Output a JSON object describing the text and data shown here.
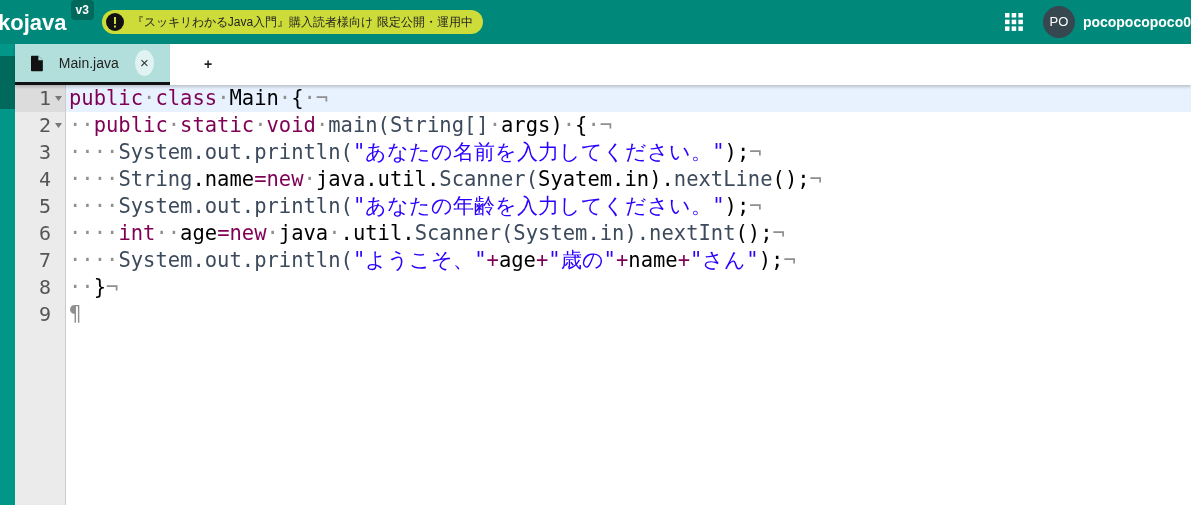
{
  "header": {
    "brand": "kojava",
    "version": "v3",
    "notice": "『スッキリわかるJava入門』購入読者様向け 限定公開・運用中",
    "avatar": "PO",
    "username": "pocopocopoco0"
  },
  "tabs": [
    {
      "label": "Main.java",
      "kind": "file",
      "selected": true,
      "close": "×"
    },
    {
      "label": "+",
      "kind": "add",
      "selected": false
    }
  ],
  "editor": {
    "lines": [
      {
        "number": "1",
        "foldable": true,
        "active": true,
        "tokens": [
          {
            "kind": "keyword",
            "text": "public"
          },
          {
            "kind": "ws",
            "text": "·"
          },
          {
            "kind": "keyword",
            "text": "class"
          },
          {
            "kind": "ws",
            "text": "·"
          },
          {
            "kind": "plain",
            "text": "Main"
          },
          {
            "kind": "ws",
            "text": "·"
          },
          {
            "kind": "plain",
            "text": "{"
          },
          {
            "kind": "ws",
            "text": "·¬"
          }
        ]
      },
      {
        "number": "2",
        "foldable": true,
        "active": false,
        "tokens": [
          {
            "kind": "ws",
            "text": "··"
          },
          {
            "kind": "keyword",
            "text": "public"
          },
          {
            "kind": "ws",
            "text": "·"
          },
          {
            "kind": "keyword",
            "text": "static"
          },
          {
            "kind": "ws",
            "text": "·"
          },
          {
            "kind": "keyword",
            "text": "void"
          },
          {
            "kind": "ws",
            "text": "·"
          },
          {
            "kind": "ident",
            "text": "main(String[]"
          },
          {
            "kind": "ws",
            "text": "·"
          },
          {
            "kind": "plain",
            "text": "args)"
          },
          {
            "kind": "ws",
            "text": "·"
          },
          {
            "kind": "plain",
            "text": "{"
          },
          {
            "kind": "ws",
            "text": "·¬"
          }
        ]
      },
      {
        "number": "3",
        "foldable": false,
        "active": false,
        "tokens": [
          {
            "kind": "ws",
            "text": "····"
          },
          {
            "kind": "ident",
            "text": "System.out.println("
          },
          {
            "kind": "string",
            "text": "\"あなたの名前を入力してください。\""
          },
          {
            "kind": "plain",
            "text": ");"
          },
          {
            "kind": "ws",
            "text": "¬"
          }
        ]
      },
      {
        "number": "4",
        "foldable": false,
        "active": false,
        "tokens": [
          {
            "kind": "ws",
            "text": "····"
          },
          {
            "kind": "ident",
            "text": "String"
          },
          {
            "kind": "plain",
            "text": ".name"
          },
          {
            "kind": "operator",
            "text": "="
          },
          {
            "kind": "keyword",
            "text": "new"
          },
          {
            "kind": "ws",
            "text": "·"
          },
          {
            "kind": "plain",
            "text": "java.util."
          },
          {
            "kind": "ident",
            "text": "Scanner("
          },
          {
            "kind": "plain",
            "text": "Syatem.in)."
          },
          {
            "kind": "ident",
            "text": "nextLine"
          },
          {
            "kind": "plain",
            "text": "();"
          },
          {
            "kind": "ws",
            "text": "¬"
          }
        ]
      },
      {
        "number": "5",
        "foldable": false,
        "active": false,
        "tokens": [
          {
            "kind": "ws",
            "text": "····"
          },
          {
            "kind": "ident",
            "text": "System.out.println("
          },
          {
            "kind": "string",
            "text": "\"あなたの年齢を入力してください。\""
          },
          {
            "kind": "plain",
            "text": ");"
          },
          {
            "kind": "ws",
            "text": "¬"
          }
        ]
      },
      {
        "number": "6",
        "foldable": false,
        "active": false,
        "tokens": [
          {
            "kind": "ws",
            "text": "····"
          },
          {
            "kind": "keyword",
            "text": "int"
          },
          {
            "kind": "ws",
            "text": "··"
          },
          {
            "kind": "plain",
            "text": "age"
          },
          {
            "kind": "operator",
            "text": "="
          },
          {
            "kind": "keyword",
            "text": "new"
          },
          {
            "kind": "ws",
            "text": "·"
          },
          {
            "kind": "plain",
            "text": "java"
          },
          {
            "kind": "ws",
            "text": "·"
          },
          {
            "kind": "plain",
            "text": ".util."
          },
          {
            "kind": "ident",
            "text": "Scanner(System.in).nextInt"
          },
          {
            "kind": "plain",
            "text": "();"
          },
          {
            "kind": "ws",
            "text": "¬"
          }
        ]
      },
      {
        "number": "7",
        "foldable": false,
        "active": false,
        "tokens": [
          {
            "kind": "ws",
            "text": "····"
          },
          {
            "kind": "ident",
            "text": "System.out.println("
          },
          {
            "kind": "string",
            "text": "\"ようこそ、\""
          },
          {
            "kind": "operator",
            "text": "+"
          },
          {
            "kind": "plain",
            "text": "age"
          },
          {
            "kind": "operator",
            "text": "+"
          },
          {
            "kind": "string",
            "text": "\"歳の\""
          },
          {
            "kind": "operator",
            "text": "+"
          },
          {
            "kind": "plain",
            "text": "name"
          },
          {
            "kind": "operator",
            "text": "+"
          },
          {
            "kind": "string",
            "text": "\"さん\""
          },
          {
            "kind": "plain",
            "text": ");"
          },
          {
            "kind": "ws",
            "text": "¬"
          }
        ]
      },
      {
        "number": "8",
        "foldable": false,
        "active": false,
        "tokens": [
          {
            "kind": "ws",
            "text": "··"
          },
          {
            "kind": "plain",
            "text": "}"
          },
          {
            "kind": "ws",
            "text": "¬"
          }
        ]
      },
      {
        "number": "9",
        "foldable": false,
        "active": false,
        "tokens": [
          {
            "kind": "ws",
            "text": "¶"
          }
        ]
      }
    ]
  }
}
